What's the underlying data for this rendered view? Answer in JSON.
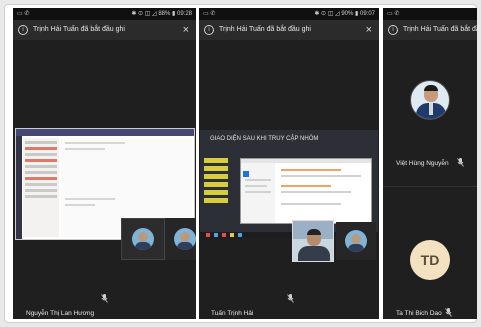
{
  "phones": [
    {
      "status_right": "✱ ⊙ ◫ ◿ 88% ▮ 09:28",
      "banner": "Trịnh Hải Tuấn đã bắt đầu ghi",
      "participant_name": "Nguyễn Thị Lan Hương"
    },
    {
      "status_right": "✱ ⊙ ◫ ◿ 90% ▮ 09:07",
      "banner": "Trịnh Hải Tuấn đã bắt đầu ghi",
      "shared_title": "GIAO DIỆN SAU KHI TRUY CẬP NHÓM",
      "participant_name": "Tuấn Trịnh Hải"
    },
    {
      "banner": "Trịnh Hải Tuấn đã bắt đầu ghi",
      "participant_top": "Việt Hùng Nguyễn",
      "avatar_initials": "TD",
      "participant_bottom": "Ta Thi Bich Dao"
    }
  ],
  "icons": {
    "info": "info-icon",
    "close": "close-icon",
    "mic_off": "mic-off-icon"
  },
  "glyphs": {
    "info": "i",
    "close": "×"
  },
  "colors": {
    "screen_bg": "#1f1f1f",
    "banner_bg": "#2b2b2b",
    "teams_purple": "#464775"
  }
}
